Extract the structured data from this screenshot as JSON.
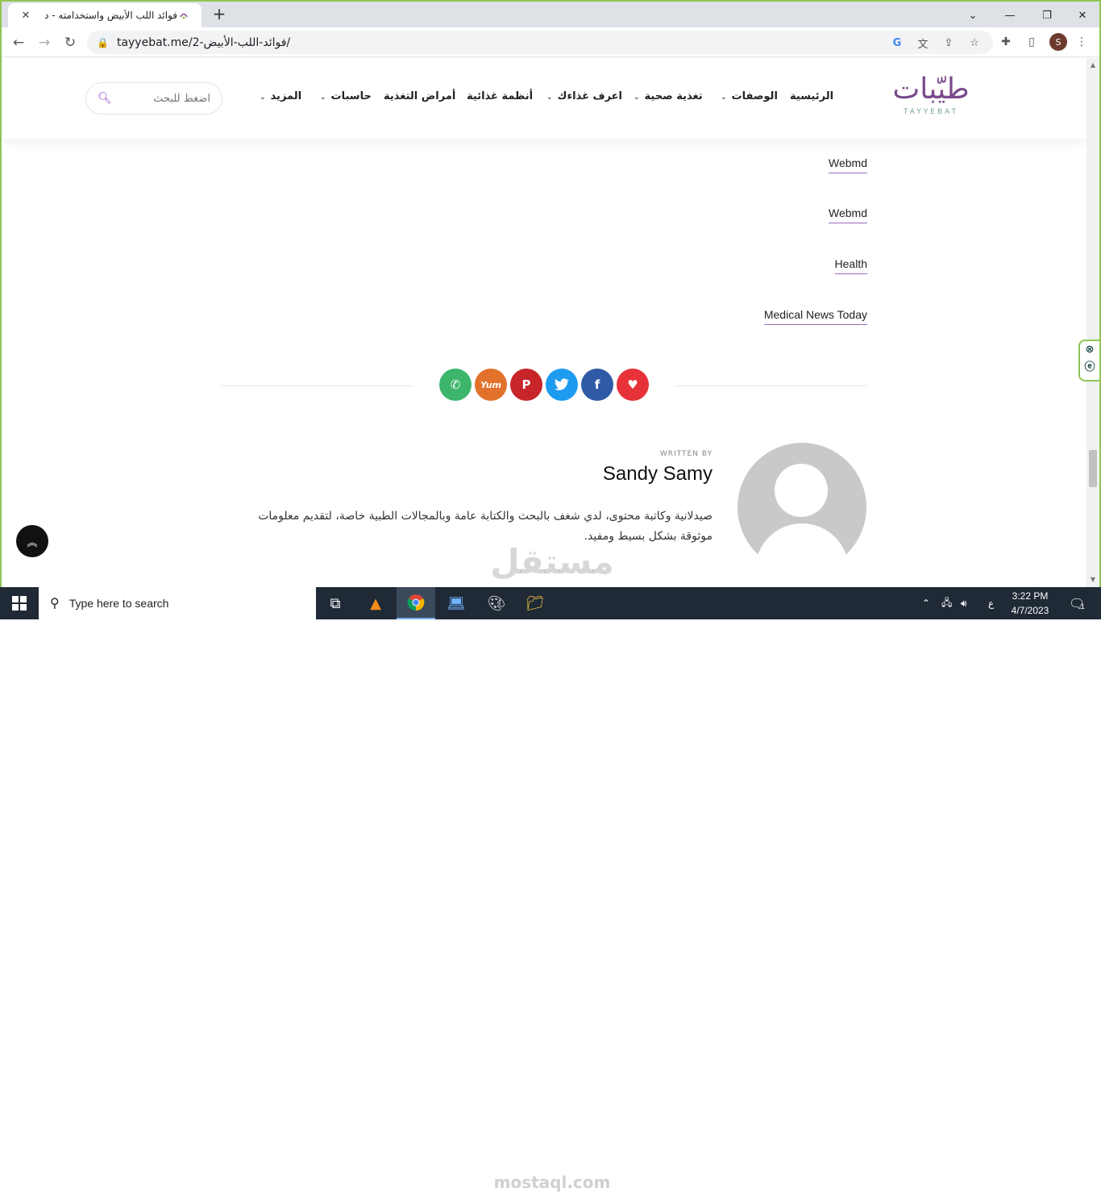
{
  "browser": {
    "tab_title": "فوائد اللب الأبيض واستخدامته - د",
    "url": "tayyebat.me/فوائد-اللب-الأبيض-2/",
    "profile_initial": "S"
  },
  "site": {
    "logo_ar": "طيّبات",
    "logo_en": "TAYYEBAT",
    "nav": [
      "الرئيسية",
      "الوصفات",
      "تغذية صحية",
      "اعرف غذاءك",
      "أنظمة غذائية",
      "أمراض التغذية",
      "حاسبات",
      "المزيد"
    ],
    "search_placeholder": "اضغط للبحث"
  },
  "sources": [
    "Webmd",
    "Webmd",
    "Health",
    "Medical News Today"
  ],
  "share_buttons": [
    "whatsapp",
    "yummly",
    "pinterest",
    "twitter",
    "facebook",
    "heart"
  ],
  "author": {
    "written_by": "WRITTEN BY",
    "name": "Sandy Samy",
    "bio": "صيدلانية وكاتبة محتوى، لدي شغف بالبحث والكتابة عامة وبالمجالات الطبية خاصة، لتقديم معلومات موثوقة بشكل بسيط ومفيد."
  },
  "watermark": {
    "ar": "مستقل",
    "en": "mostaql.com"
  },
  "taskbar": {
    "search_text": "Type here to search",
    "time": "3:22 PM",
    "date": "4/7/2023",
    "lang": "ع",
    "notifications": "1"
  },
  "colors": {
    "accent": "#8a3fc7",
    "brand": "#7a4a8c"
  }
}
